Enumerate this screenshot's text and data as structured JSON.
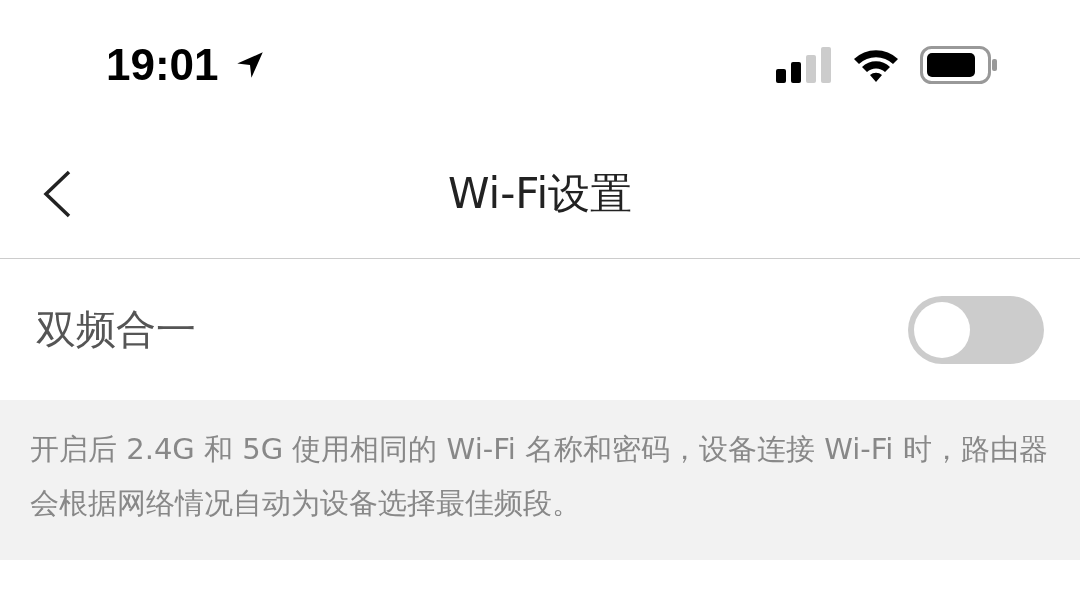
{
  "status_bar": {
    "time": "19:01"
  },
  "nav": {
    "title": "Wi-Fi设置"
  },
  "settings": [
    {
      "kind": "toggle",
      "label": "双频合一",
      "on": false
    }
  ],
  "description": "开启后 2.4G 和 5G 使用相同的 Wi-Fi 名称和密码，设备连接 Wi-Fi 时，路由器会根据网络情况自动为设备选择最佳频段。"
}
